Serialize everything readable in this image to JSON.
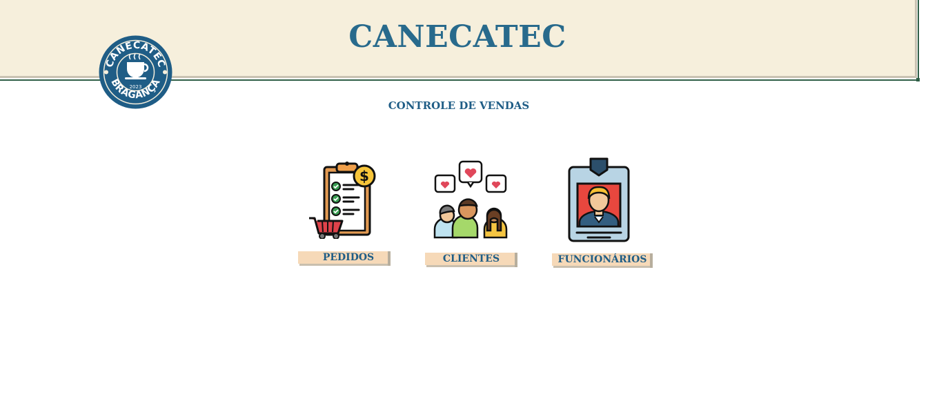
{
  "header": {
    "title": "CANECATEC",
    "logo": {
      "icon": "canecatec-coffee-cup-logo",
      "top_text": "CANECATEC",
      "bottom_text": "BRAGANÇA",
      "year": "2023"
    }
  },
  "subtitle": "CONTROLE DE VENDAS",
  "menu": {
    "items": [
      {
        "label": "PEDIDOS",
        "icon": "clipboard-cart-icon"
      },
      {
        "label": "CLIENTES",
        "icon": "people-hearts-icon"
      },
      {
        "label": "FUNCIONÁRIOS",
        "icon": "employee-badge-icon"
      }
    ]
  },
  "colors": {
    "header_bg": "#f6efdc",
    "title": "#286a8c",
    "subtitle": "#1f5d86",
    "ribbon": "#f6d9b8",
    "border": "#2f5e46"
  }
}
